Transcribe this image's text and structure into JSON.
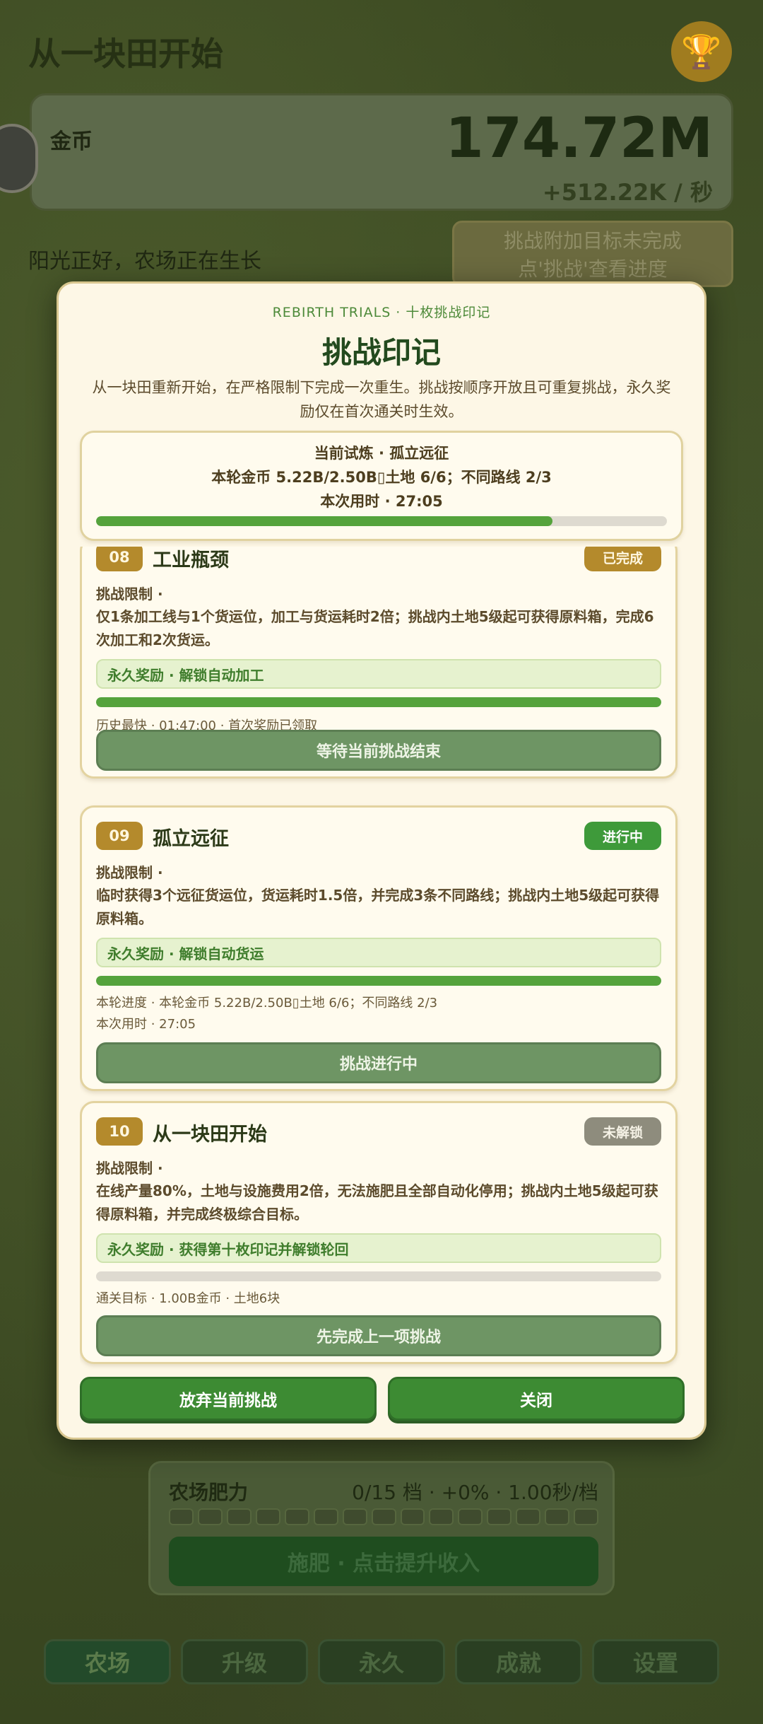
{
  "app": {
    "title": "从一块田开始",
    "coins_label": "金币",
    "coins_value": "174.72M",
    "coins_rate": "+512.22K / 秒",
    "status_text": "阳光正好，农场正在生长",
    "challenge_hint": "挑战附加目标未完成\n点'挑战'查看进度",
    "fertility": {
      "label": "农场肥力",
      "stats": "0/15 档 · +0% · 1.00秒/档",
      "level": 0,
      "max": 15,
      "button": "施肥 · 点击提升收入"
    },
    "nav": [
      "农场",
      "升级",
      "永久",
      "成就",
      "设置"
    ],
    "active_tab": "农场"
  },
  "modal": {
    "eyebrow": "REBIRTH TRIALS · 十枚挑战印记",
    "title": "挑战印记",
    "description": "从一块田重新开始，在严格限制下完成一次重生。挑战按顺序开放且可重复挑战，永久奖励仅在首次通关时生效。",
    "current": {
      "line1": "当前试炼 · 孤立远征",
      "line2": "本轮金币 5.22B/2.50B▯土地 6/6；不同路线 2/3",
      "line3": "本次用时 · 27:05",
      "progress": 0.8
    },
    "cards": [
      {
        "num": "08",
        "title": "工业瓶颈",
        "status": "已完成",
        "limit_label": "挑战限制 ·",
        "limit_text": "仅1条加工线与1个货运位，加工与货运耗时2倍；挑战内土地5级起可获得原料箱，完成6次加工和2次货运。",
        "reward": "永久奖励 · 解锁自动加工",
        "progress": 1.0,
        "meta1": "历史最快 · 01:47:00 · 首次奖励已领取",
        "meta2": "",
        "button": "等待当前挑战结束"
      },
      {
        "num": "09",
        "title": "孤立远征",
        "status": "进行中",
        "limit_label": "挑战限制 ·",
        "limit_text": "临时获得3个远征货运位，货运耗时1.5倍，并完成3条不同路线；挑战内土地5级起可获得原料箱。",
        "reward": "永久奖励 · 解锁自动货运",
        "progress": 1.0,
        "meta1": "本轮进度 · 本轮金币 5.22B/2.50B▯土地 6/6；不同路线 2/3",
        "meta2": "本次用时 · 27:05",
        "button": "挑战进行中"
      },
      {
        "num": "10",
        "title": "从一块田开始",
        "status": "未解锁",
        "limit_label": "挑战限制 ·",
        "limit_text": "在线产量80%，土地与设施费用2倍，无法施肥且全部自动化停用；挑战内土地5级起可获得原料箱，并完成终极综合目标。",
        "reward": "永久奖励 · 获得第十枚印记并解锁轮回",
        "progress": 0.0,
        "meta1": "通关目标 · 1.00B金币 · 土地6块",
        "meta2": "",
        "button": "先完成上一项挑战"
      }
    ],
    "abandon_button": "放弃当前挑战",
    "close_button": "关闭"
  }
}
